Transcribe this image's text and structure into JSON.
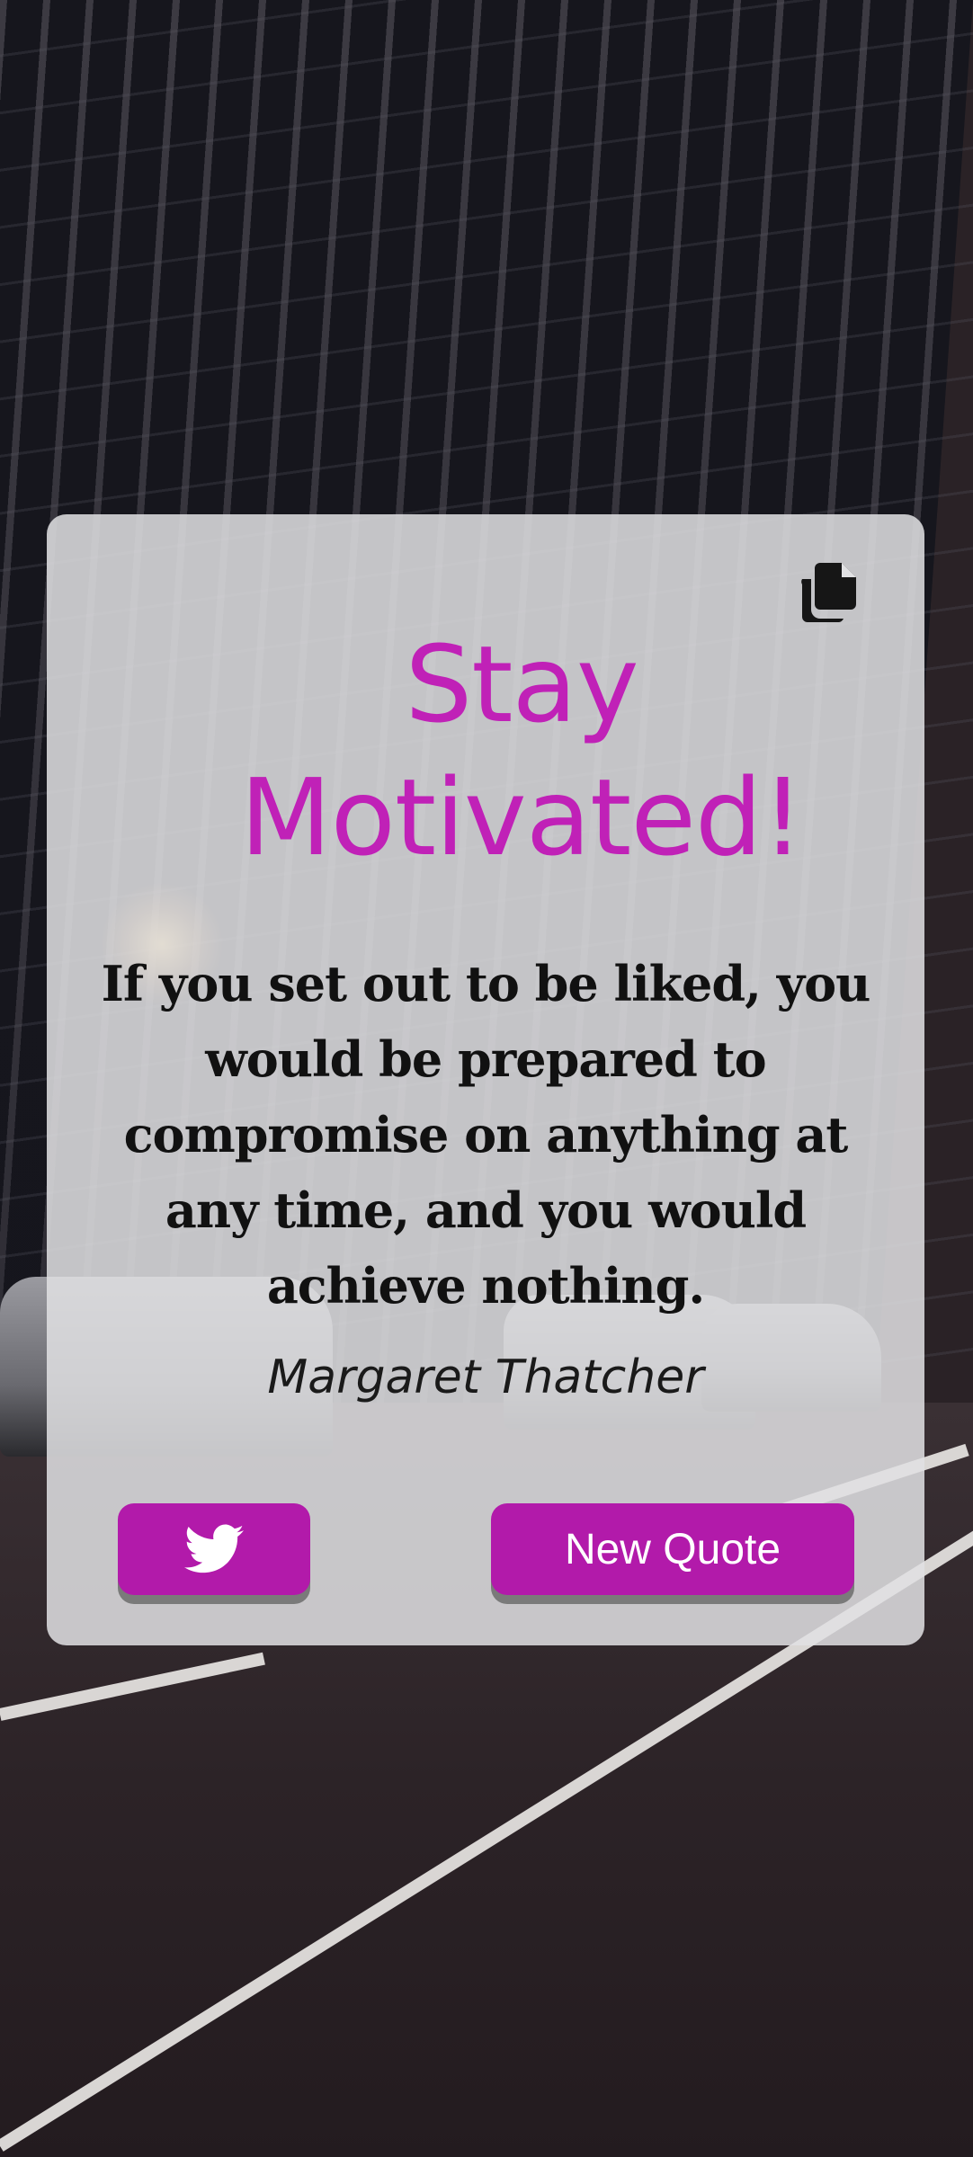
{
  "app": {
    "title": "Stay Motivated!",
    "accent_color": "#c021b7",
    "button_color": "#b21aaa"
  },
  "card": {
    "copy_icon": "copy-icon",
    "quote_text": "If you set out to be liked, you would be prepared to compromise on anything at any time, and you would achieve nothing.",
    "author": "Margaret Thatcher"
  },
  "actions": {
    "tweet_icon": "twitter-bird-icon",
    "new_quote_label": "New Quote"
  }
}
